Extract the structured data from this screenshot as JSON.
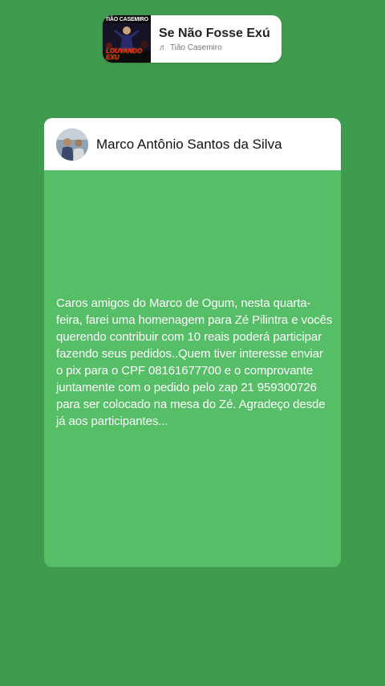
{
  "music_sticker": {
    "album_top_text": "TIÃO CASEMIRO",
    "album_bottom_line1": "LOUVANDO",
    "album_bottom_line2": "EXU",
    "song_title": "Se Não Fosse Exú",
    "artist": "Tião Casemiro",
    "note_icon": "music-note-icon"
  },
  "post": {
    "author": "Marco Antônio Santos da Silva",
    "text": "Caros amigos do Marco de Ogum, nesta quarta-feira, farei uma homenagem para Zé Pilintra e vocês  querendo contribuir com 10 reais poderá participar fazendo seus pedidos..Quem tiver interesse enviar o  pix para o CPF 08161677700 e o comprovante  juntamente com o pedido pelo zap 21 959300726 para ser colocado na mesa do Zé. Agradeço desde já aos participantes...",
    "card_color": "#55be66",
    "background_color": "#3f9c4e"
  }
}
